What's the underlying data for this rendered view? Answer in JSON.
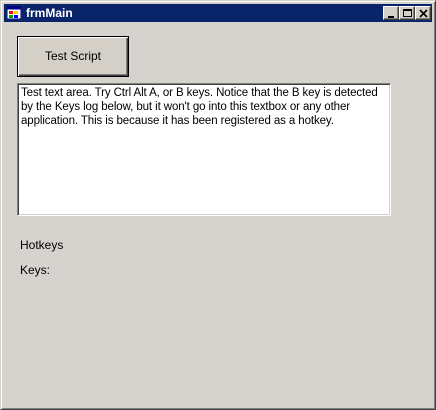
{
  "window": {
    "title": "frmMain"
  },
  "titlebar_buttons": {
    "minimize_icon": "minimize-icon",
    "maximize_icon": "maximize-icon",
    "close_icon": "close-icon"
  },
  "test_button": {
    "label": "Test Script"
  },
  "text_area": {
    "value": "Test text area.  Try Ctrl Alt A, or B keys.  Notice that the B key is detected by the Keys log below, but it won't go into this textbox or any other application.  This is because it has been registered as a hotkey."
  },
  "labels": {
    "hotkeys": "Hotkeys",
    "keys": "Keys:"
  },
  "colors": {
    "titlebar": "#0a246a",
    "face": "#d4d0c8"
  }
}
